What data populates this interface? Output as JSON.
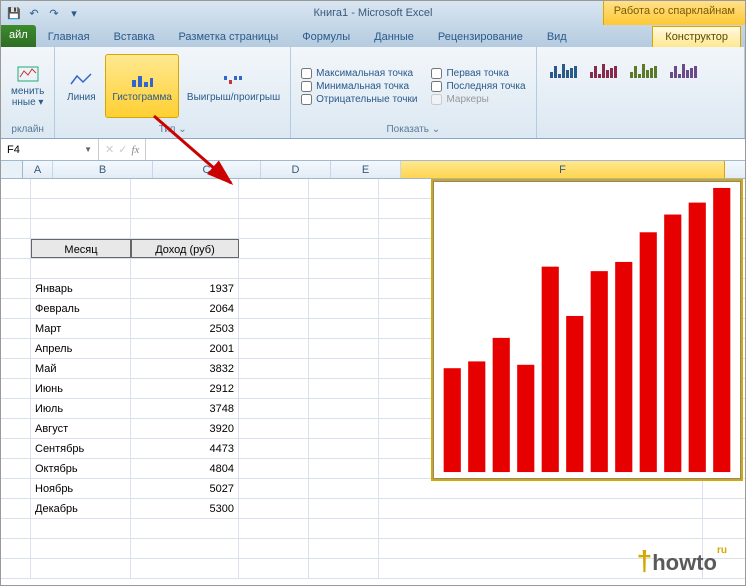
{
  "title": "Книга1 - Microsoft Excel",
  "context_tab": "Работа со спарклайнам",
  "tabs": {
    "file": "айл",
    "home": "Главная",
    "insert": "Вставка",
    "layout": "Разметка страницы",
    "formulas": "Формулы",
    "data": "Данные",
    "review": "Рецензирование",
    "view": "Вид",
    "design": "Конструктор"
  },
  "ribbon": {
    "data_grp": {
      "edit": "менить",
      "edit2": "нные",
      "label": "рклайн"
    },
    "type_grp": {
      "line": "Линия",
      "histogram": "Гистограмма",
      "winloss": "Выигрыш/проигрыш",
      "label": "Тип"
    },
    "show_grp": {
      "max": "Максимальная точка",
      "min": "Минимальная точка",
      "neg": "Отрицательные точки",
      "first": "Первая точка",
      "last": "Последняя точка",
      "markers": "Маркеры",
      "label": "Показать"
    }
  },
  "namebox": "F4",
  "columns": [
    "A",
    "B",
    "C",
    "D",
    "E",
    "F"
  ],
  "table": {
    "headers": {
      "month": "Месяц",
      "income": "Доход (руб)"
    },
    "rows": [
      {
        "m": "Январь",
        "v": "1937"
      },
      {
        "m": "Февраль",
        "v": "2064"
      },
      {
        "m": "Март",
        "v": "2503"
      },
      {
        "m": "Апрель",
        "v": "2001"
      },
      {
        "m": "Май",
        "v": "3832"
      },
      {
        "m": "Июнь",
        "v": "2912"
      },
      {
        "m": "Июль",
        "v": "3748"
      },
      {
        "m": "Август",
        "v": "3920"
      },
      {
        "m": "Сентябрь",
        "v": "4473"
      },
      {
        "m": "Октябрь",
        "v": "4804"
      },
      {
        "m": "Ноябрь",
        "v": "5027"
      },
      {
        "m": "Декабрь",
        "v": "5300"
      }
    ]
  },
  "chart_data": {
    "type": "bar",
    "categories": [
      "Январь",
      "Февраль",
      "Март",
      "Апрель",
      "Май",
      "Июнь",
      "Июль",
      "Август",
      "Сентябрь",
      "Октябрь",
      "Ноябрь",
      "Декабрь"
    ],
    "values": [
      1937,
      2064,
      2503,
      2001,
      3832,
      2912,
      3748,
      3920,
      4473,
      4804,
      5027,
      5300
    ],
    "title": "",
    "xlabel": "",
    "ylabel": "",
    "ylim": [
      0,
      5300
    ]
  },
  "logo": {
    "brand": "howto",
    "suffix": "ru"
  }
}
